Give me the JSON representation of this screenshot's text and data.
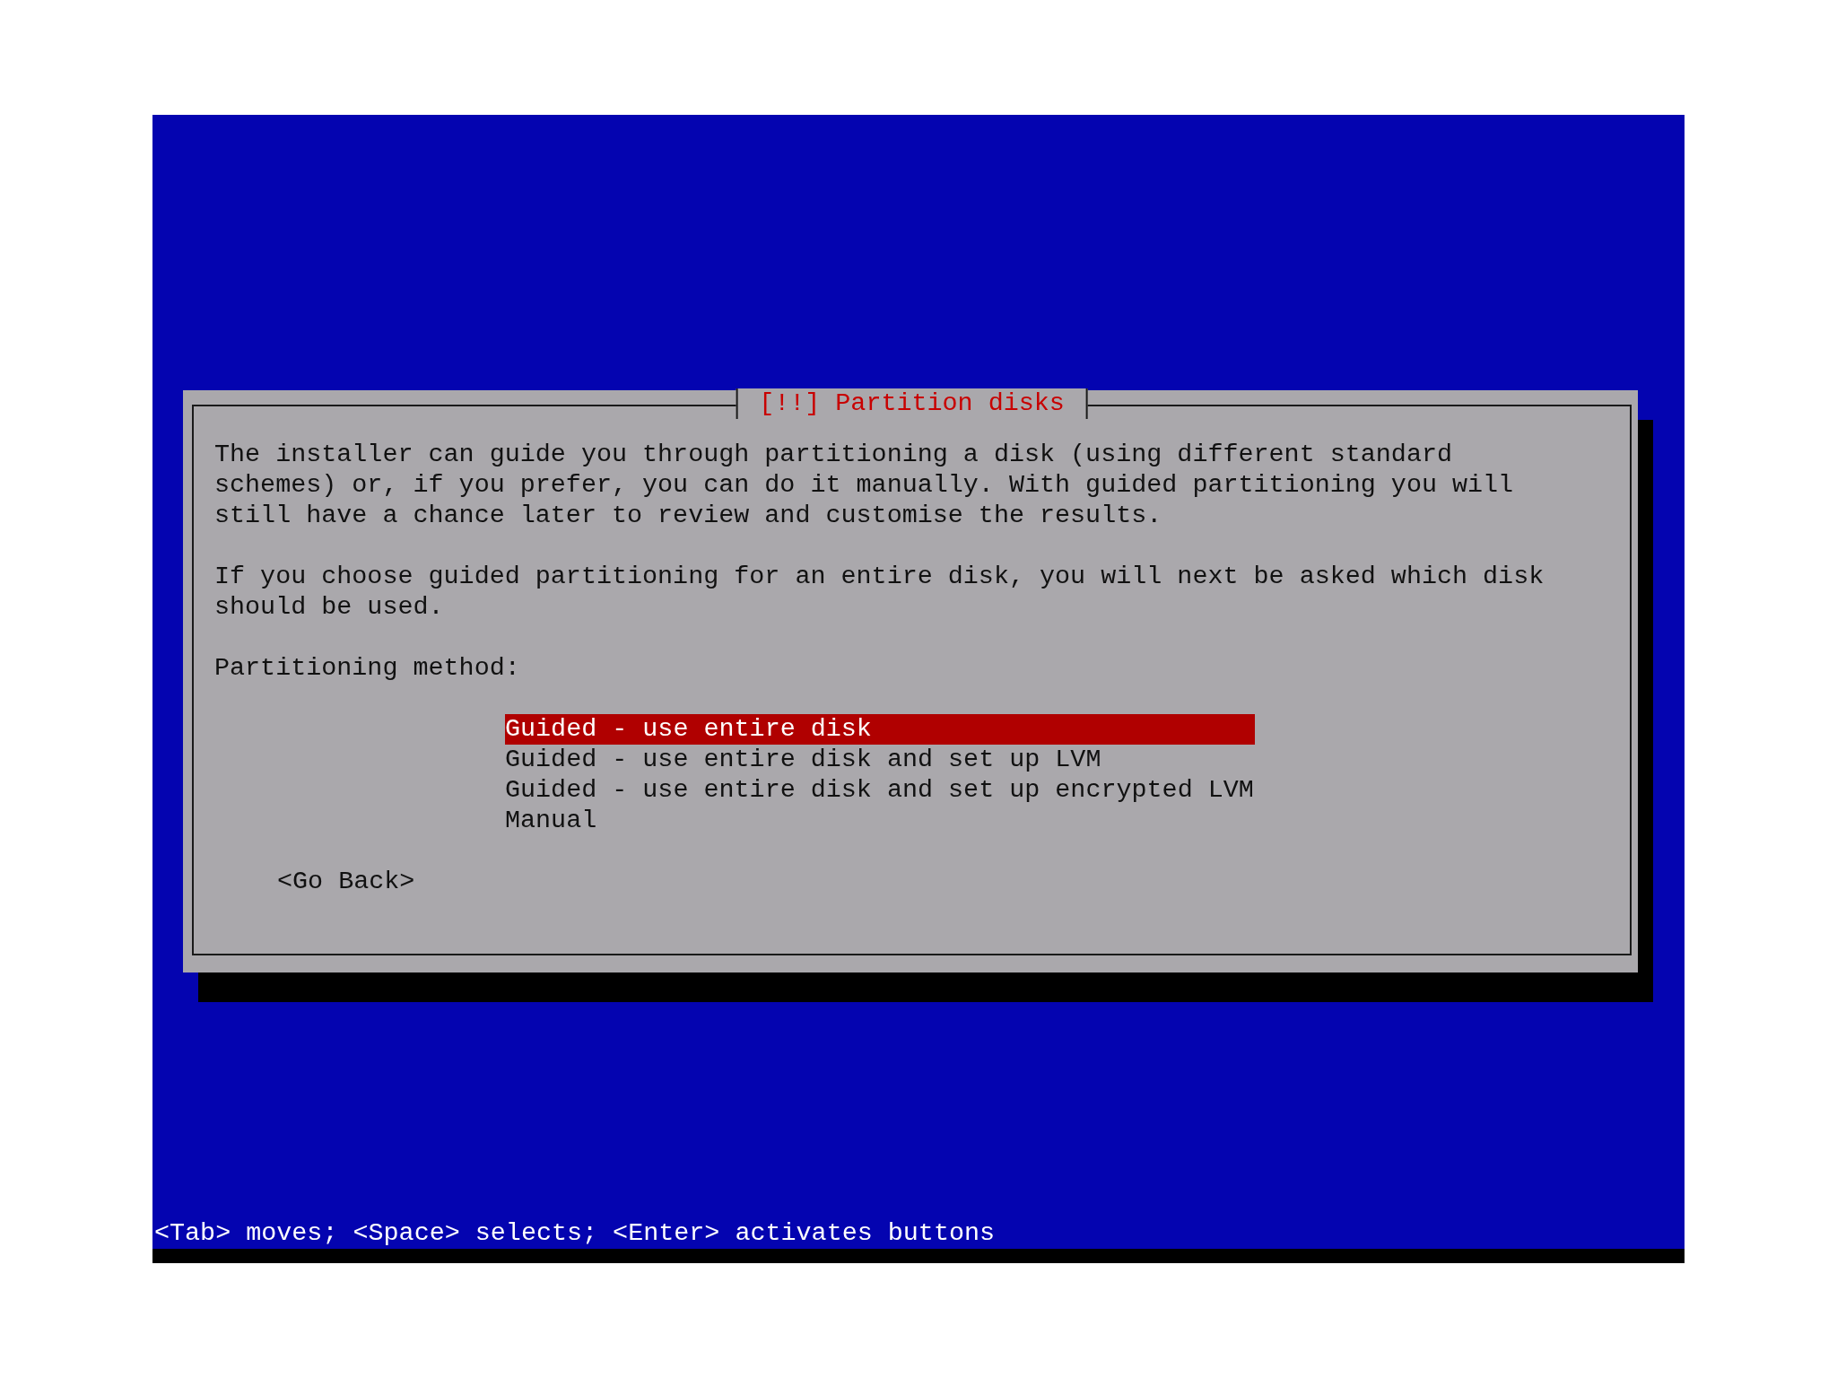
{
  "dialog": {
    "title": "[!!] Partition disks",
    "paragraphs": [
      "The installer can guide you through partitioning a disk (using different standard\nschemes) or, if you prefer, you can do it manually. With guided partitioning you will\nstill have a chance later to review and customise the results.",
      "If you choose guided partitioning for an entire disk, you will next be asked which disk\nshould be used."
    ],
    "prompt": "Partitioning method:",
    "options": [
      {
        "label": "Guided - use entire disk",
        "selected": true
      },
      {
        "label": "Guided - use entire disk and set up LVM",
        "selected": false
      },
      {
        "label": "Guided - use entire disk and set up encrypted LVM",
        "selected": false
      },
      {
        "label": "Manual",
        "selected": false
      }
    ],
    "button": "<Go Back>"
  },
  "status_bar": "<Tab> moves; <Space> selects; <Enter> activates buttons"
}
